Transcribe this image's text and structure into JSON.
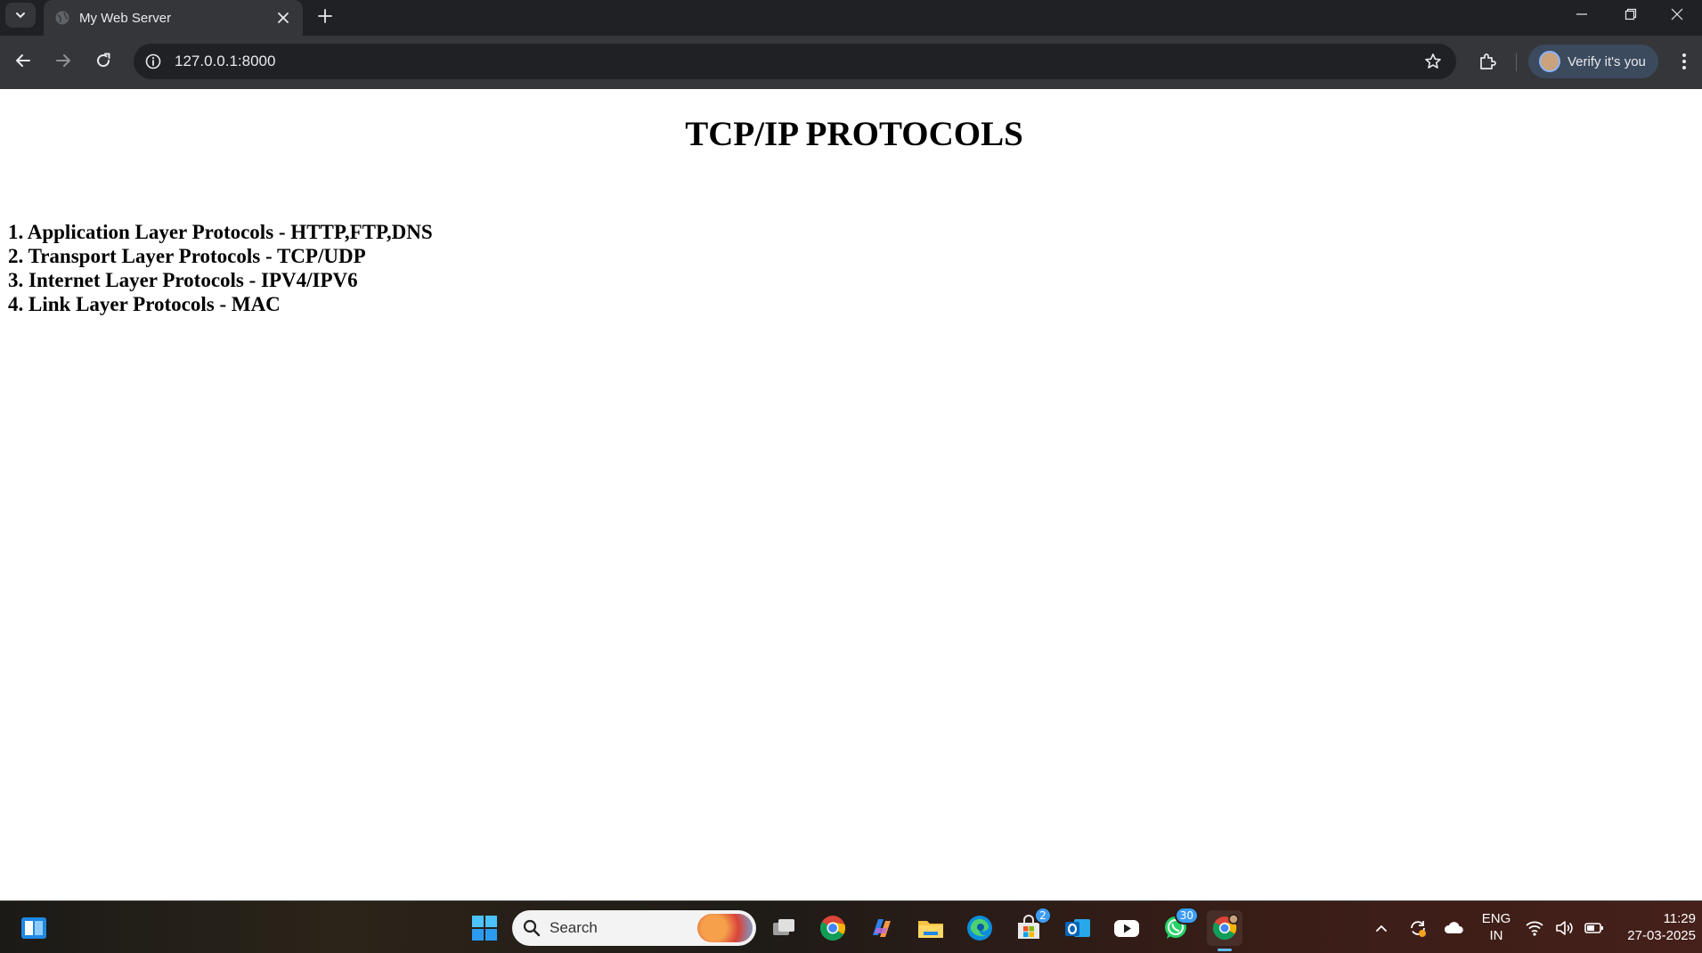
{
  "browser": {
    "tab_title": "My Web Server",
    "url": "127.0.0.1:8000",
    "profile_label": "Verify it's you"
  },
  "page": {
    "heading": "TCP/IP PROTOCOLS",
    "items": [
      "1. Application Layer Protocols - HTTP,FTP,DNS",
      "2. Transport Layer Protocols - TCP/UDP",
      "3. Internet Layer Protocols - IPV4/IPV6",
      "4. Link Layer Protocols - MAC"
    ]
  },
  "taskbar": {
    "search_placeholder": "Search",
    "store_badge": "2",
    "whatsapp_badge": "30",
    "language_line1": "ENG",
    "language_line2": "IN",
    "time": "11:29",
    "date": "27-03-2025"
  },
  "colors": {
    "chrome_dark": "#1f2124",
    "toolbar": "#35363a",
    "omnibox": "#202124",
    "accent": "#8ab4f8"
  }
}
